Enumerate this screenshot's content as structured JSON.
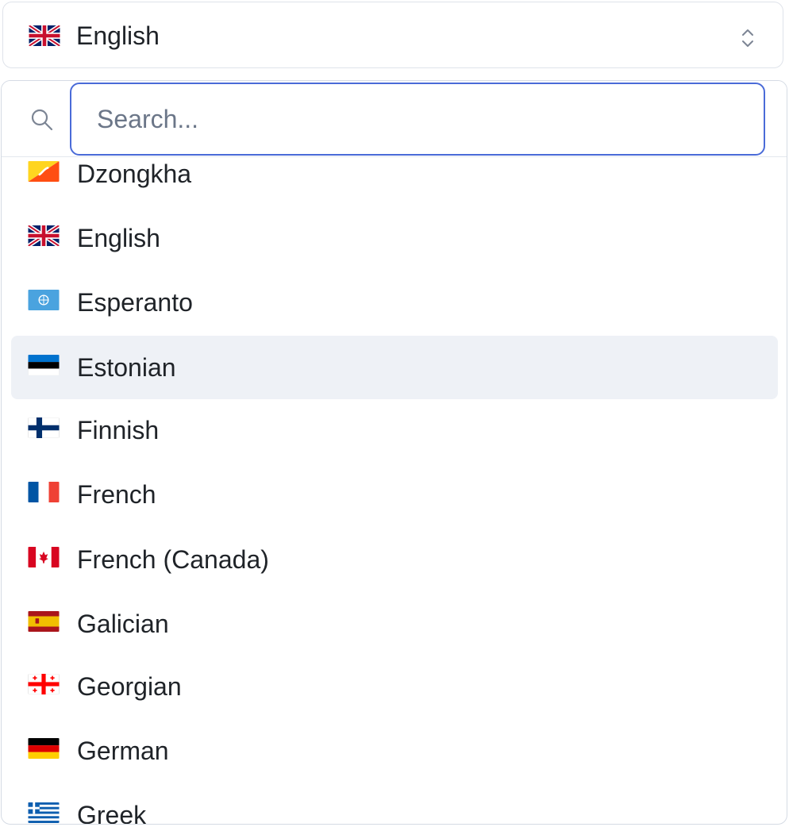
{
  "select": {
    "selected_label": "English",
    "selected_flag": "united-kingdom-flag-icon",
    "chevron_icon": "chevron-up-down-icon"
  },
  "search": {
    "placeholder": "Search...",
    "value": "",
    "icon": "search-icon"
  },
  "options": [
    {
      "label": "Dzongkha",
      "flag": "bhutan-flag-icon"
    },
    {
      "label": "English",
      "flag": "united-kingdom-flag-icon"
    },
    {
      "label": "Esperanto",
      "flag": "esperanto-flag-icon"
    },
    {
      "label": "Estonian",
      "flag": "estonia-flag-icon",
      "highlighted": true
    },
    {
      "label": "Finnish",
      "flag": "finland-flag-icon"
    },
    {
      "label": "French",
      "flag": "france-flag-icon"
    },
    {
      "label": "French (Canada)",
      "flag": "canada-flag-icon"
    },
    {
      "label": "Galician",
      "flag": "spain-flag-icon"
    },
    {
      "label": "Georgian",
      "flag": "georgia-flag-icon"
    },
    {
      "label": "German",
      "flag": "germany-flag-icon"
    },
    {
      "label": "Greek",
      "flag": "greece-flag-icon"
    }
  ],
  "colors": {
    "focus_ring": "#4a6bd8",
    "highlight_background": "#eef1f6",
    "border": "#dfe3ea"
  }
}
